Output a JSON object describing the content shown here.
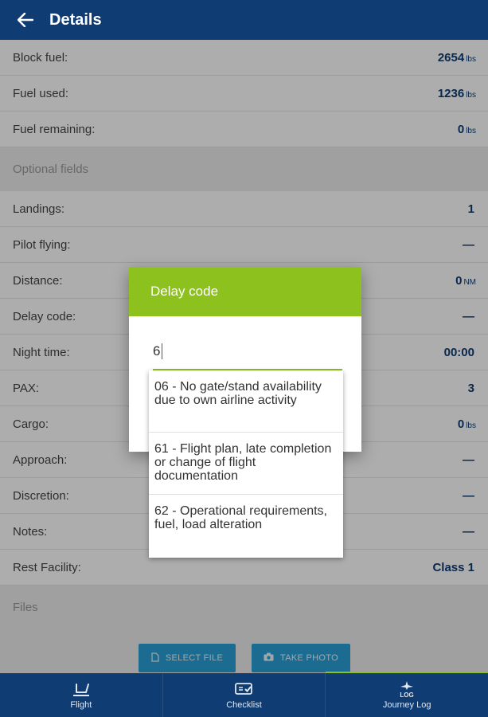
{
  "appbar": {
    "title": "Details"
  },
  "fuel_rows": [
    {
      "label": "Block fuel:",
      "value": "2654",
      "unit": "lbs"
    },
    {
      "label": "Fuel used:",
      "value": "1236",
      "unit": "lbs"
    },
    {
      "label": "Fuel remaining:",
      "value": "0",
      "unit": "lbs"
    }
  ],
  "optional_section": {
    "title": "Optional fields"
  },
  "optional_rows": [
    {
      "label": "Landings:",
      "value": "1",
      "unit": ""
    },
    {
      "label": "Pilot flying:",
      "value": "—",
      "unit": ""
    },
    {
      "label": "Distance:",
      "value": "0",
      "unit": "NM"
    },
    {
      "label": "Delay code:",
      "value": "—",
      "unit": ""
    },
    {
      "label": "Night time:",
      "value": "00:00",
      "unit": ""
    },
    {
      "label": "PAX:",
      "value": "3",
      "unit": ""
    },
    {
      "label": "Cargo:",
      "value": "0",
      "unit": "lbs"
    },
    {
      "label": "Approach:",
      "value": "—",
      "unit": ""
    },
    {
      "label": "Discretion:",
      "value": "—",
      "unit": ""
    },
    {
      "label": "Notes:",
      "value": "—",
      "unit": ""
    },
    {
      "label": "Rest Facility:",
      "value": "Class 1",
      "unit": ""
    }
  ],
  "files_section": {
    "title": "Files"
  },
  "file_buttons": {
    "select_label": "SELECT FILE",
    "photo_label": "TAKE PHOTO"
  },
  "dialog": {
    "title": "Delay code",
    "input_value": "6",
    "suggestions": [
      "06 - No gate/stand availability due to own airline activity",
      "61 - Flight plan, late completion or change of flight documentation",
      "62 - Operational requirements, fuel, load alteration"
    ]
  },
  "bottom_nav": {
    "items": [
      {
        "label": "Flight",
        "icon": "flight-takeoff-icon"
      },
      {
        "label": "Checklist",
        "icon": "checklist-icon"
      },
      {
        "label": "Journey Log",
        "icon": "journey-log-icon",
        "icon_text": "LOG"
      }
    ],
    "active_index": 2
  },
  "colors": {
    "primary": "#0f3c73",
    "accent": "#8dc21e",
    "button": "#2aa0d8"
  }
}
